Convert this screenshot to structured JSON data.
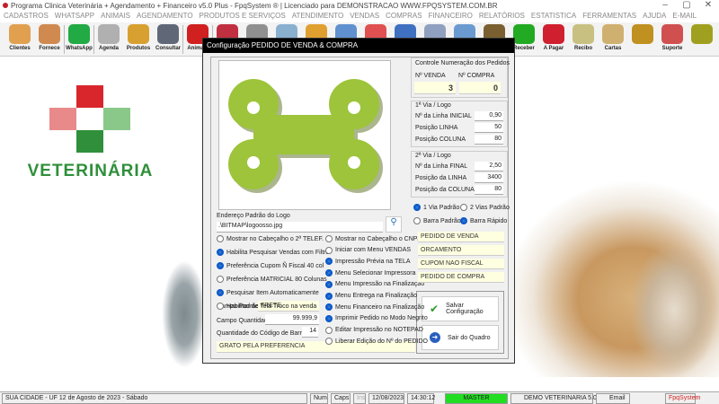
{
  "window": {
    "title": "Programa Clinica Veterinária + Agendamento + Financeiro v5.0 Plus - FpqSystem ® | Licenciado para  DEMONSTRACAO WWW.FPQSYSTEM.COM.BR",
    "minimize": "–",
    "maximize": "▢",
    "close": "✕"
  },
  "menu": [
    "CADASTROS",
    "WHATSAPP",
    "ANIMAIS",
    "AGENDAMENTO",
    "PRODUTOS E SERVIÇOS",
    "ATENDIMENTO",
    "VENDAS",
    "COMPRAS",
    "FINANCEIRO",
    "RELATÓRIOS",
    "ESTATISTICA",
    "FERRAMENTAS",
    "AJUDA",
    "E-MAIL"
  ],
  "toolbar": [
    "Clientes",
    "Fornece",
    "WhatsApp",
    "Agenda",
    "Produtos",
    "Consultar",
    "Animais",
    "",
    "",
    "",
    "",
    "",
    "",
    "",
    "",
    "",
    "",
    "Receber",
    "A Pagar",
    "Recibo",
    "Cartas",
    "",
    "Suporte",
    ""
  ],
  "logo": {
    "text": "VETERINÁRIA"
  },
  "dialog": {
    "title": "Configuração PEDIDO DE VENDA & COMPRA",
    "logo_label": "Endereço Padrão do Logo",
    "logo_path": ".\\BITMAP\\logoosso.jpg",
    "left_options": [
      {
        "label": "Mostrar no Cabeçalho o 2ª TELEF.",
        "on": false
      },
      {
        "label": "Habilita Pesquisar Vendas com Filtro",
        "on": true
      },
      {
        "label": "Preferência Cupom Ñ Fiscal 40 col",
        "on": true
      },
      {
        "label": "Preferência MATRICIAL 80 Colunas",
        "on": false
      },
      {
        "label": "Pesquisar Item Automaticamente",
        "on": true
      },
      {
        "label": "Habilitar de Tela Troco na venda",
        "on": false
      }
    ],
    "mid_options": [
      {
        "label": "Mostrar no Cabeçalho o CNPJ",
        "on": false
      },
      {
        "label": "Iniciar com Menu VENDAS",
        "on": false
      },
      {
        "label": "Impressão Prévia na TELA",
        "on": true
      },
      {
        "label": "Menu Selecionar Impressora",
        "on": true
      },
      {
        "label": "Menu Impressão na Finalização",
        "on": true
      },
      {
        "label": "Menu Entrega na Finalização",
        "on": true
      },
      {
        "label": "Menu Financeiro na Finalização",
        "on": true
      },
      {
        "label": "Imprimir Pedido no Modo Negrito",
        "on": true
      },
      {
        "label": "Editar Impressão no NOTEPAD",
        "on": false
      },
      {
        "label": "Liberar Edição do Nº do PEDIDO",
        "on": false
      }
    ],
    "campo_padrao_label": "Campo Padrão",
    "campo_padrao": "FRETE",
    "campo_qtd_label": "Campo Quantidade",
    "campo_qtd": "99.999,9",
    "barras_label": "Quantidade do Código de Barras",
    "barras": "14",
    "footer_msg": "GRATO PELA PREFERENCIA",
    "numeracao": {
      "title": "Controle Numeração dos Pedidos",
      "venda_label": "Nº VENDA",
      "venda": "3",
      "compra_label": "Nº COMPRA",
      "compra": "0"
    },
    "via1": {
      "title": "1ª Via / Logo",
      "rows": [
        {
          "label": "Nº da Linha INICIAL",
          "value": "0,90"
        },
        {
          "label": "Posição LINHA",
          "value": "50"
        },
        {
          "label": "Posição COLUNA",
          "value": "80"
        }
      ]
    },
    "via2": {
      "title": "2ª Via / Logo",
      "rows": [
        {
          "label": "Nº da Linha FINAL",
          "value": "2,50"
        },
        {
          "label": "Posição da LINHA",
          "value": "3400"
        },
        {
          "label": "Posição da COLUNA",
          "value": "80"
        }
      ]
    },
    "radios": [
      {
        "label": "1 Via Padrão",
        "on": true
      },
      {
        "label": "2 Vias Padrão",
        "on": false
      },
      {
        "label": "Barra Padrão",
        "on": false
      },
      {
        "label": "Barra Rápido",
        "on": true
      }
    ],
    "titles": [
      "PEDIDO DE VENDA",
      "ORCAMENTO",
      "CUPOM NAO FISCAL",
      "PEDIDO DE COMPRA"
    ],
    "save": "Salvar Configuração",
    "exit": "Sair do Quadro"
  },
  "status": {
    "city": "SUA CIDADE - UF 12 de Agosto de 2023 - Sábado",
    "num": "Num",
    "caps": "Caps",
    "ins": "Ins",
    "date": "12/08/2023",
    "time": "14:30:12",
    "user": "MASTER",
    "demo": "DEMO VETERINARIA 5.0",
    "email": "Email",
    "brand": "FpqSystem"
  },
  "colors": {
    "accent": "#0a58c8",
    "bone": "#9dc43a",
    "master": "#22dd22"
  }
}
